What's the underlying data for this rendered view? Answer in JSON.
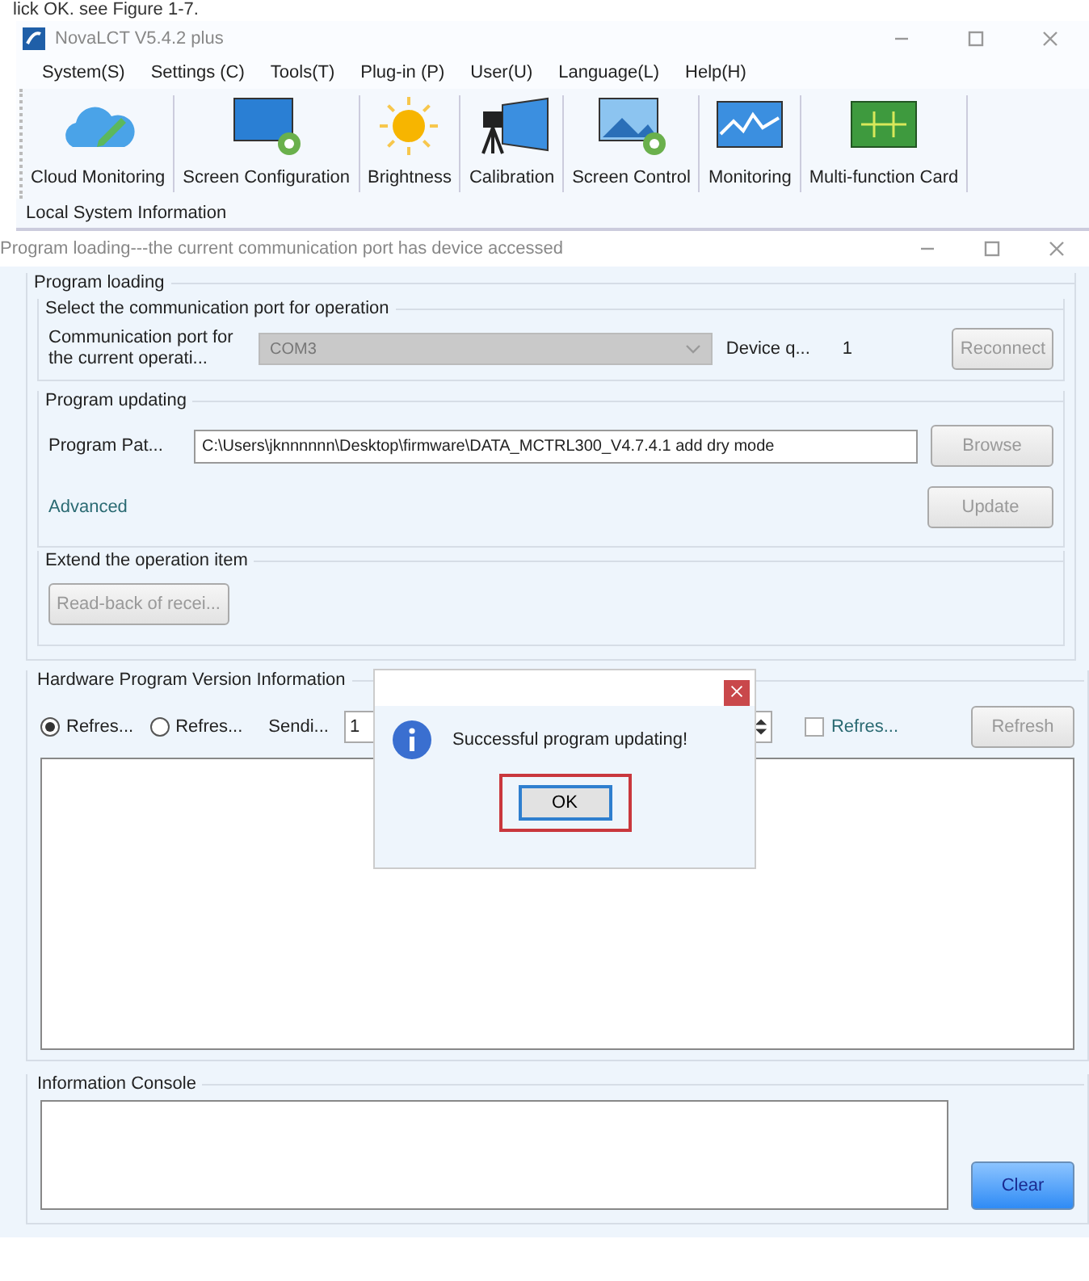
{
  "caption": "lick OK. see Figure 1-7.",
  "window": {
    "title": "NovaLCT V5.4.2 plus"
  },
  "menu": [
    "System(S)",
    "Settings (C)",
    "Tools(T)",
    "Plug-in (P)",
    "User(U)",
    "Language(L)",
    "Help(H)"
  ],
  "toolbar": [
    {
      "kind": "cloud",
      "label": "Cloud Monitoring"
    },
    {
      "kind": "screen-config",
      "label": "Screen Configuration"
    },
    {
      "kind": "sun",
      "label": "Brightness"
    },
    {
      "kind": "camera",
      "label": "Calibration"
    },
    {
      "kind": "screen-control",
      "label": "Screen Control"
    },
    {
      "kind": "monitor",
      "label": "Monitoring"
    },
    {
      "kind": "card",
      "label": "Multi-function Card"
    }
  ],
  "local_info": "Local System Information",
  "subwindow": {
    "title": "Program loading---the current communication port has device accessed"
  },
  "program_loading": {
    "title": "Program loading",
    "port_group": {
      "title": "Select the communication port for operation",
      "port_label": "Communication port for the current operati...",
      "port_value": "COM3",
      "port_disabled": true,
      "device_label": "Device q...",
      "device_count": "1",
      "reconnect": {
        "label": "Reconnect",
        "disabled": true
      }
    },
    "updating": {
      "title": "Program updating",
      "path_label": "Program Pat...",
      "path_value": "C:\\Users\\jknnnnnn\\Desktop\\firmware\\DATA_MCTRL300_V4.7.4.1 add dry mode",
      "browse": {
        "label": "Browse",
        "disabled": true
      },
      "advanced": "Advanced",
      "update": {
        "label": "Update",
        "disabled": true
      }
    },
    "extend": {
      "title": "Extend the operation item",
      "readback": {
        "label": "Read-back of recei...",
        "disabled": true
      }
    }
  },
  "hardware": {
    "title": "Hardware Program Version Information",
    "radios": [
      {
        "label": "Refres...",
        "selected": true
      },
      {
        "label": "Refres...",
        "selected": false
      }
    ],
    "sending_label": "Sendi...",
    "sending_value": "1",
    "auto_refresh": {
      "label": "Refres...",
      "checked": false
    },
    "refresh": {
      "label": "Refresh",
      "disabled": true
    }
  },
  "console": {
    "title": "Information Console",
    "clear": {
      "label": "Clear",
      "disabled": false
    }
  },
  "dialog": {
    "message": "Successful program updating!",
    "ok": "OK",
    "highlighted": true
  }
}
